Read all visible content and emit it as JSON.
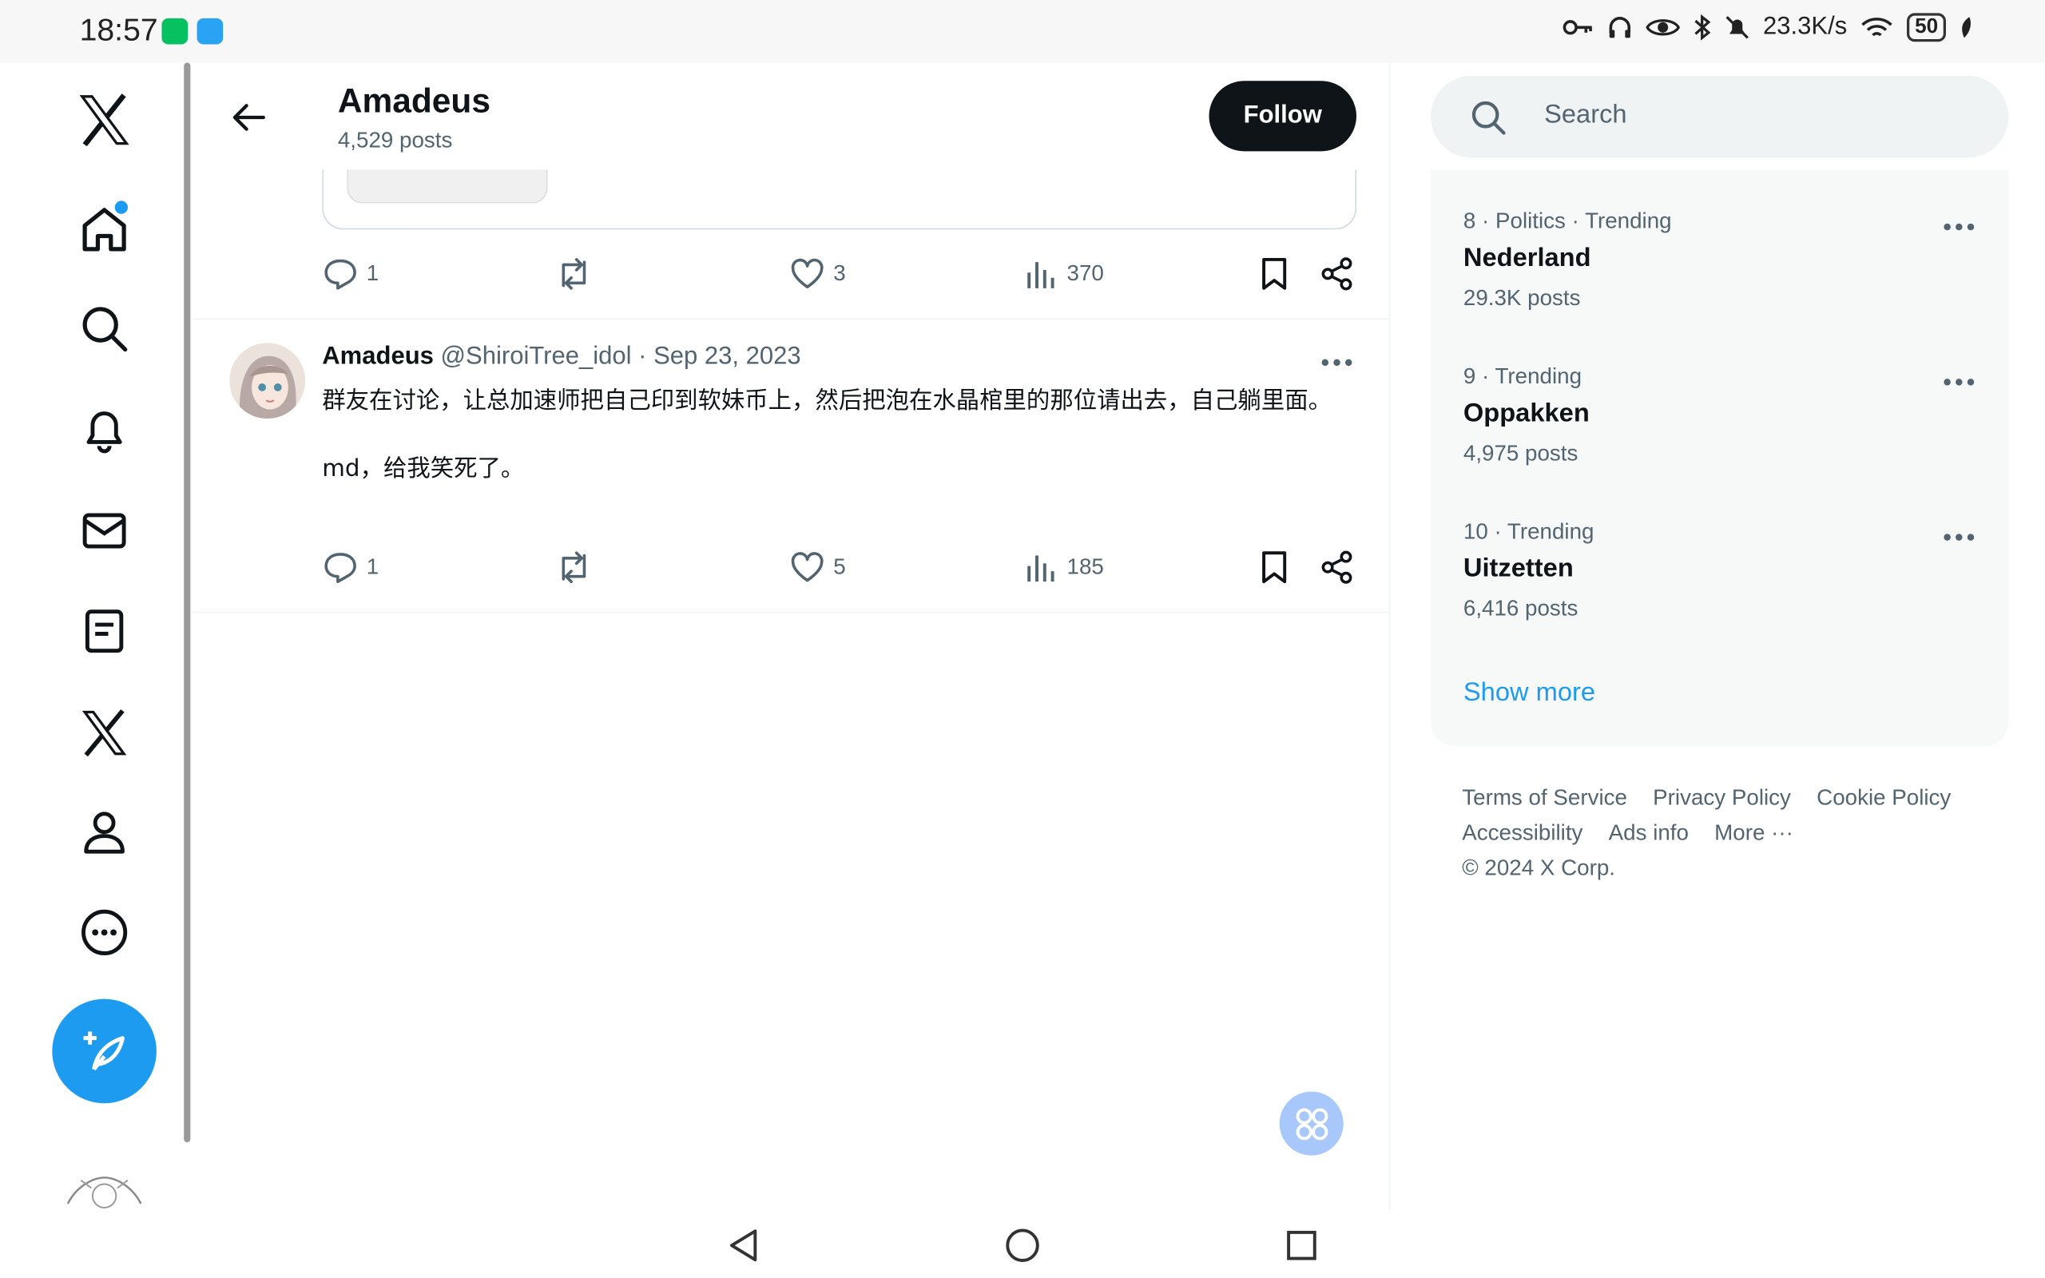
{
  "status_bar": {
    "time": "18:57",
    "net_speed": "23.3K/s",
    "battery": "50"
  },
  "header": {
    "title": "Amadeus",
    "post_count": "4,529 posts",
    "follow_label": "Follow"
  },
  "prev_tweet": {
    "replies": "1",
    "likes": "3",
    "views": "370"
  },
  "tweet": {
    "name": "Amadeus",
    "meta": "@ShiroiTree_idol · Sep 23, 2023",
    "text_line1": "群友在讨论，让总加速师把自己印到软妹币上，然后把泡在水晶棺里的那位请出去，自己躺里面。",
    "text_line2": "md，给我笑死了。",
    "replies": "1",
    "likes": "5",
    "views": "185"
  },
  "search": {
    "placeholder": "Search"
  },
  "trends": [
    {
      "context": "8 · Politics · Trending",
      "topic": "Nederland",
      "count": "29.3K posts"
    },
    {
      "context": "9 · Trending",
      "topic": "Oppakken",
      "count": "4,975 posts"
    },
    {
      "context": "10 · Trending",
      "topic": "Uitzetten",
      "count": "6,416 posts"
    }
  ],
  "show_more": "Show more",
  "footer": {
    "terms": "Terms of Service",
    "privacy": "Privacy Policy",
    "cookie": "Cookie Policy",
    "accessibility": "Accessibility",
    "ads": "Ads info",
    "more": "More ···",
    "copyright": "© 2024 X Corp."
  },
  "colors": {
    "accent": "#1d9bf0",
    "text": "#0f1419",
    "muted": "#536471"
  }
}
